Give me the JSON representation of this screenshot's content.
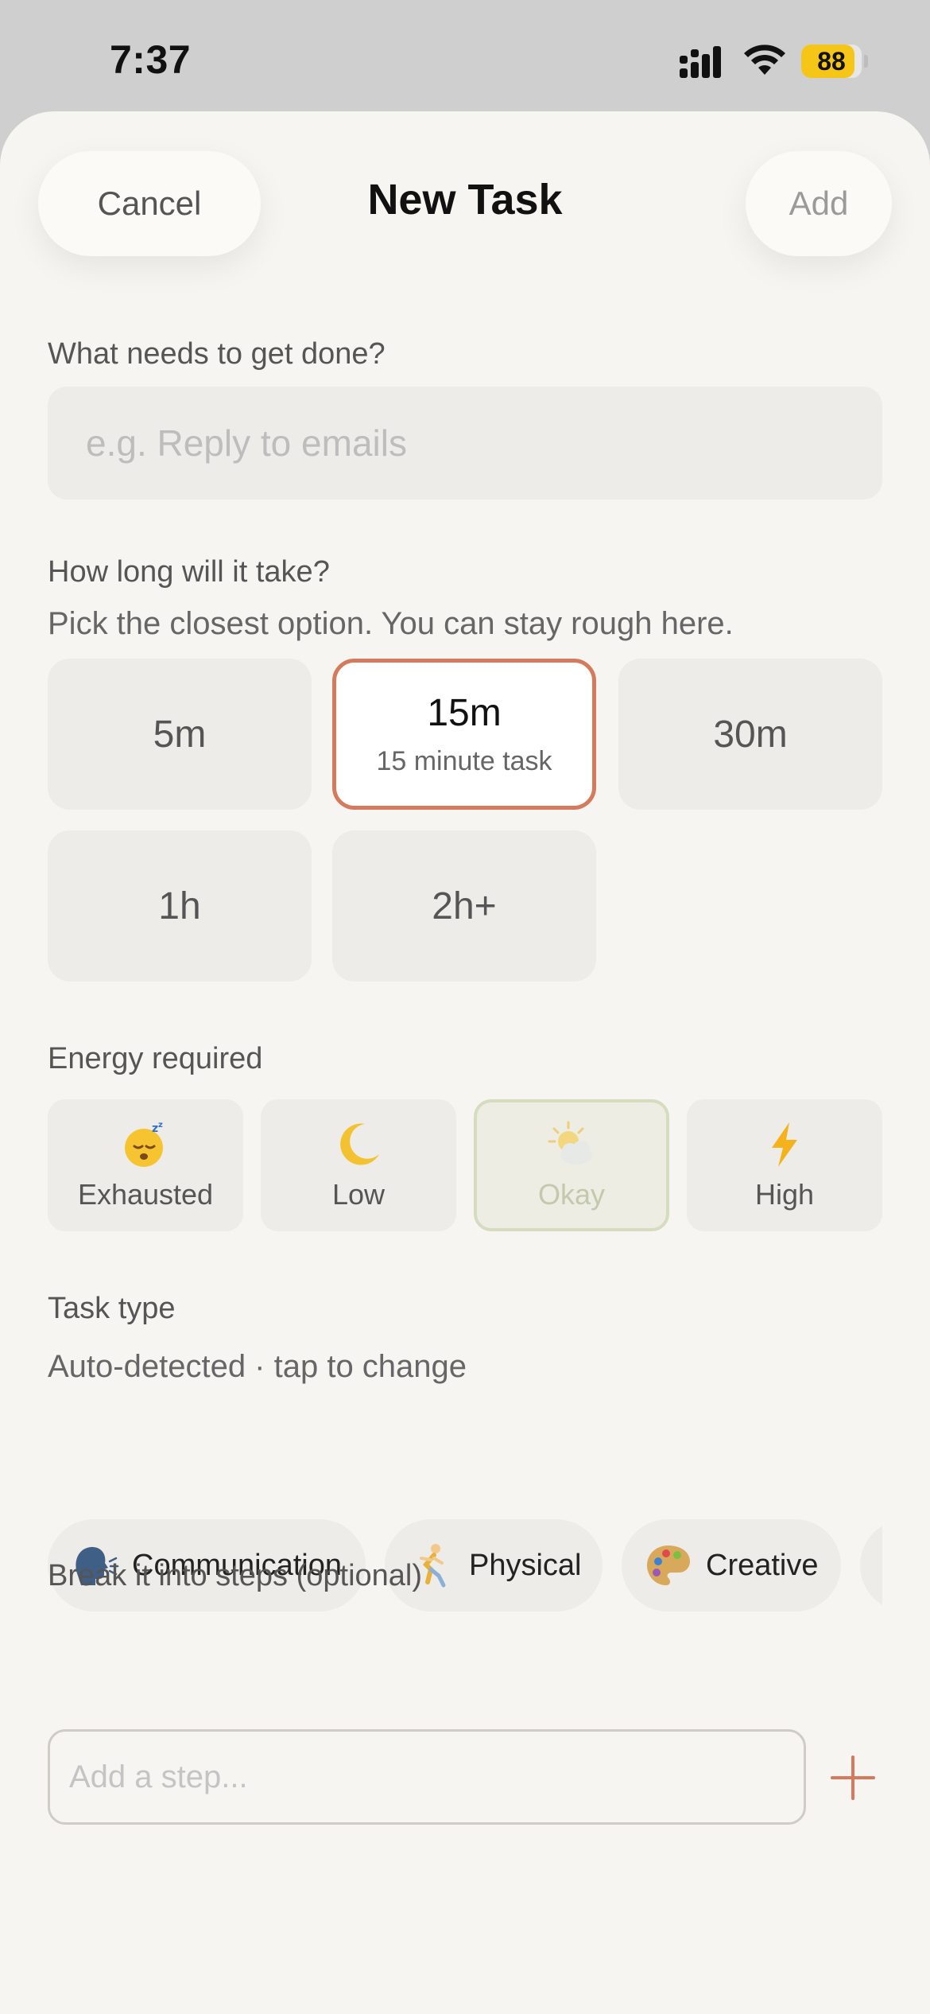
{
  "status_bar": {
    "time": "7:37",
    "battery": "88",
    "battery_level": 0.88
  },
  "header": {
    "title": "New Task",
    "cancel_label": "Cancel",
    "add_label": "Add"
  },
  "task": {
    "label": "What needs to get done?",
    "placeholder": "e.g. Reply to emails"
  },
  "duration": {
    "label": "How long will it take?",
    "hint": "Pick the closest option. You can stay rough here.",
    "options": [
      {
        "label": "5m"
      },
      {
        "label": "15m",
        "detail": "15 minute task",
        "selected": true
      },
      {
        "label": "30m"
      },
      {
        "label": "1h"
      },
      {
        "label": "2h+"
      }
    ]
  },
  "energy": {
    "label": "Energy required",
    "options": [
      {
        "label": "Exhausted",
        "icon": "sleeping-face-icon"
      },
      {
        "label": "Low",
        "icon": "crescent-moon-icon"
      },
      {
        "label": "Okay",
        "icon": "sun-behind-cloud-icon",
        "selected": true
      },
      {
        "label": "High",
        "icon": "lightning-icon"
      }
    ]
  },
  "task_type": {
    "label": "Task type",
    "hint": "Auto-detected · tap to change",
    "options": [
      {
        "label": "Communication",
        "icon": "speaking-head-icon"
      },
      {
        "label": "Physical",
        "icon": "running-person-icon"
      },
      {
        "label": "Creative",
        "icon": "artist-palette-icon"
      }
    ]
  },
  "steps": {
    "label": "Break it into steps (optional)",
    "placeholder": "Add a step..."
  },
  "colors": {
    "accent": "#d57a5c",
    "selected_energy_border": "#d6dcc0",
    "card_bg": "#eeece8",
    "sheet_bg": "#f6f5f2"
  }
}
